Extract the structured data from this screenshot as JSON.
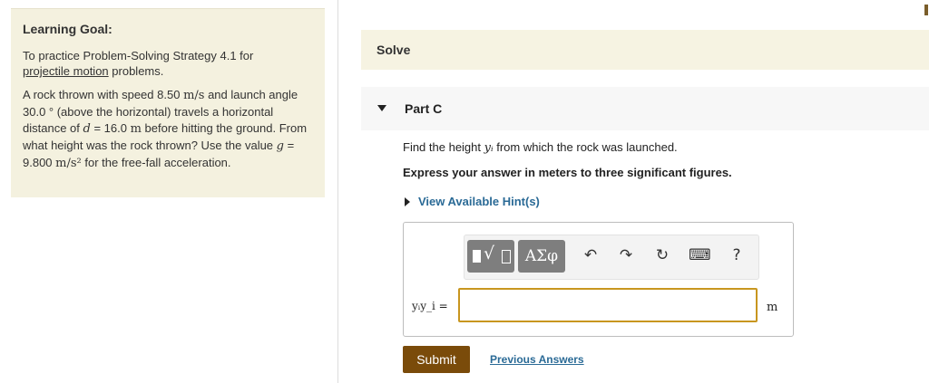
{
  "learning_goal": {
    "title": "Learning Goal:",
    "intro_prefix": "To practice Problem-Solving Strategy 4.1 for",
    "intro_link": "projectile motion",
    "intro_suffix": "problems.",
    "problem": {
      "t1": "A rock thrown with speed 8.50",
      "speed_unit": "m/s",
      "t2": "and launch angle 30.0 ° (above the horizontal) travels a horizontal distance of",
      "d_sym": "d",
      "t3": "= 16.0",
      "d_unit": "m",
      "t4": "before hitting the ground. From what height was the rock thrown? Use the value",
      "g_sym": "g",
      "t5": "= 9.800",
      "g_unit": "m/s²",
      "t6": "for the free-fall acceleration."
    }
  },
  "solve": {
    "label": "Solve"
  },
  "part": {
    "label": "Part C"
  },
  "question": {
    "prompt_prefix": "Find the height",
    "var": "yᵢ",
    "prompt_suffix": "from which the rock was launched.",
    "instruction": "Express your answer in meters to three significant figures."
  },
  "hints": {
    "label": "View Available Hint(s)"
  },
  "toolbar": {
    "symbols_label": "ΑΣφ",
    "undo_icon": "↶",
    "redo_icon": "↷",
    "reset_icon": "↻",
    "keyboard_icon": "⌨",
    "help_label": "?"
  },
  "answer": {
    "label": "yᵢy_i =",
    "value": "",
    "unit": "m"
  },
  "buttons": {
    "submit": "Submit",
    "previous_answers": "Previous Answers"
  }
}
